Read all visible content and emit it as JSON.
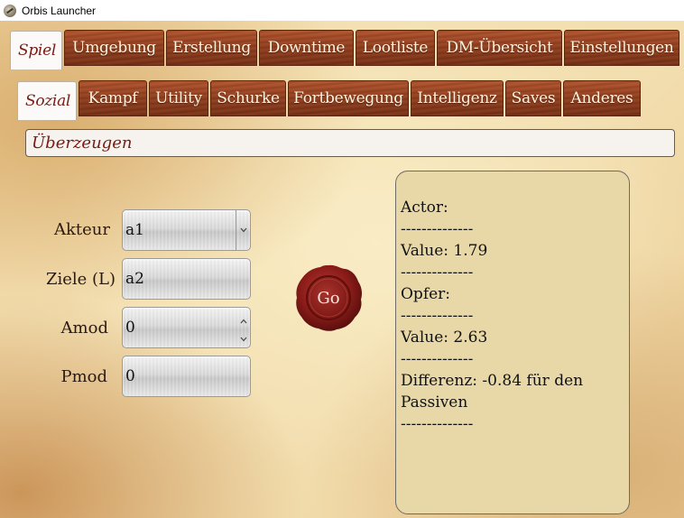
{
  "window": {
    "title": "Orbis Launcher",
    "icon": "app-logo-icon"
  },
  "main_tabs": [
    {
      "label": "Spiel",
      "active": true
    },
    {
      "label": "Umgebung",
      "active": false
    },
    {
      "label": "Erstellung",
      "active": false
    },
    {
      "label": "Downtime",
      "active": false
    },
    {
      "label": "Lootliste",
      "active": false
    },
    {
      "label": "DM-Übersicht",
      "active": false
    },
    {
      "label": "Einstellungen",
      "active": false
    }
  ],
  "sub_tabs": [
    {
      "label": "Sozial",
      "active": true
    },
    {
      "label": "Kampf",
      "active": false
    },
    {
      "label": "Utility",
      "active": false
    },
    {
      "label": "Schurke",
      "active": false
    },
    {
      "label": "Fortbewegung",
      "active": false
    },
    {
      "label": "Intelligenz",
      "active": false
    },
    {
      "label": "Saves",
      "active": false
    },
    {
      "label": "Anderes",
      "active": false
    }
  ],
  "action": {
    "selected": "Überzeugen"
  },
  "form": {
    "akteur_label": "Akteur",
    "akteur_value": "a1",
    "ziele_label": "Ziele (L)",
    "ziele_value": "a2",
    "amod_label": "Amod",
    "amod_value": "0",
    "pmod_label": "Pmod",
    "pmod_value": "0"
  },
  "go_button": {
    "label": "Go"
  },
  "result": {
    "lines": [
      "Actor:",
      "--------------",
      "Value: 1.79",
      "--------------",
      "Opfer:",
      "--------------",
      "Value: 2.63",
      "--------------",
      "Differenz: -0.84 für den Passiven",
      "--------------"
    ]
  },
  "colors": {
    "tab_wood": "#93401f",
    "active_text": "#7a1a12",
    "panel_bg": "#e8d8a8",
    "seal_red": "#8e1d1a"
  }
}
